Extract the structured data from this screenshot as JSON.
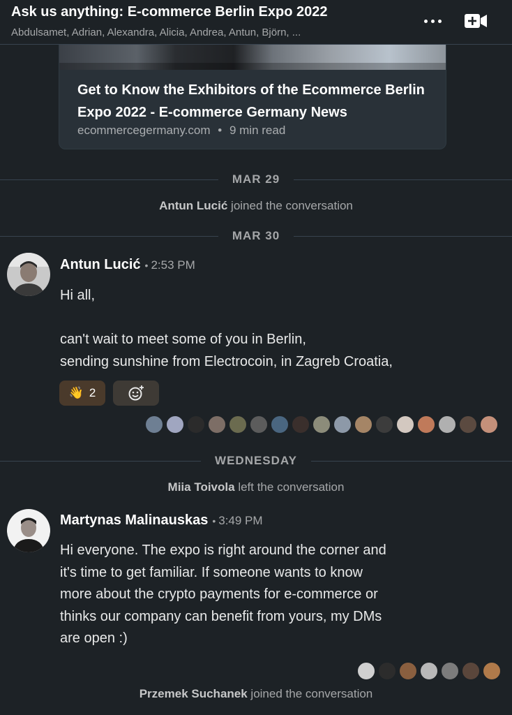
{
  "header": {
    "title": "Ask us anything: E-commerce Berlin Expo 2022",
    "participants": "Abdulsamet, Adrian, Alexandra, Alicia, Andrea, Antun, Björn, ...",
    "more_icon": "more-horizontal-icon",
    "video_icon": "video-add-icon"
  },
  "link_preview": {
    "title": "Get to Know the Exhibitors of the Ecommerce Berlin Expo 2022 - E-commerce Germany News",
    "domain": "ecommercegermany.com",
    "separator": "•",
    "read_time": "9 min read"
  },
  "dividers": {
    "mar29": "MAR 29",
    "mar30": "MAR 30",
    "wednesday": "WEDNESDAY"
  },
  "events": {
    "antun_joined_name": "Antun Lucić",
    "antun_joined_text": "joined the conversation",
    "miia_left_name": "Miia Toivola",
    "miia_left_text": "left the conversation",
    "przemek_joined_name": "Przemek Suchanek",
    "przemek_joined_text": "joined the conversation"
  },
  "messages": [
    {
      "sender": "Antun Lucić",
      "separator": "•",
      "time": "2:53 PM",
      "body": "Hi all,\n\ncan't wait to meet some of you in Berlin,\nsending sunshine from Electrocoin, in Zagreb Croatia,",
      "reaction_emoji": "👋",
      "reaction_count": "2"
    },
    {
      "sender": "Martynas Malinauskas",
      "separator": "•",
      "time": "3:49 PM",
      "body": "Hi everyone. The expo is right around the corner and\nit's time to get familiar. If someone wants to know\nmore about the crypto payments for e-commerce or\nthinks our company can benefit from yours, my DMs\nare open :)"
    }
  ],
  "colors": {
    "background": "#1d2226",
    "card": "#293138",
    "divider": "#38434f",
    "reaction": "#4a3a2b"
  }
}
